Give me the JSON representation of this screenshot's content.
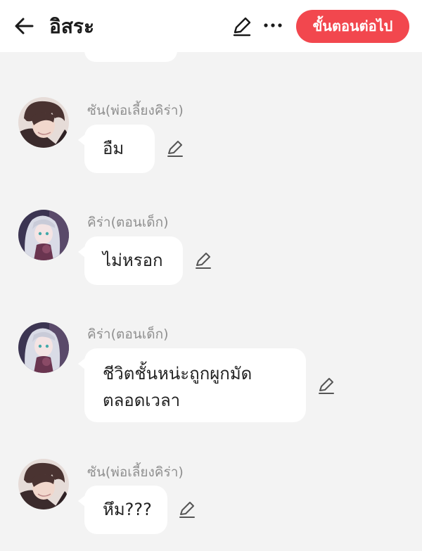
{
  "header": {
    "title": "อิสระ",
    "next_label": "ขั้นตอนต่อไป",
    "accent_color": "#f2474e"
  },
  "messages": [
    {
      "sender": "ซัน(พ่อเลี้ยงคิร่า)",
      "lines": [
        "อืม"
      ],
      "avatar": "dark-haired-boy-avatar"
    },
    {
      "sender": "คิร่า(ตอนเด็ก)",
      "lines": [
        "ไม่หรอก"
      ],
      "avatar": "silver-haired-girl-avatar"
    },
    {
      "sender": "คิร่า(ตอนเด็ก)",
      "lines": [
        "ชีวิตชั้นหน่ะถูกผูกมัด",
        "ตลอดเวลา"
      ],
      "avatar": "silver-haired-girl-avatar"
    },
    {
      "sender": "ซัน(พ่อเลี้ยงคิร่า)",
      "lines": [
        "หึม???"
      ],
      "avatar": "dark-haired-boy-avatar"
    }
  ]
}
